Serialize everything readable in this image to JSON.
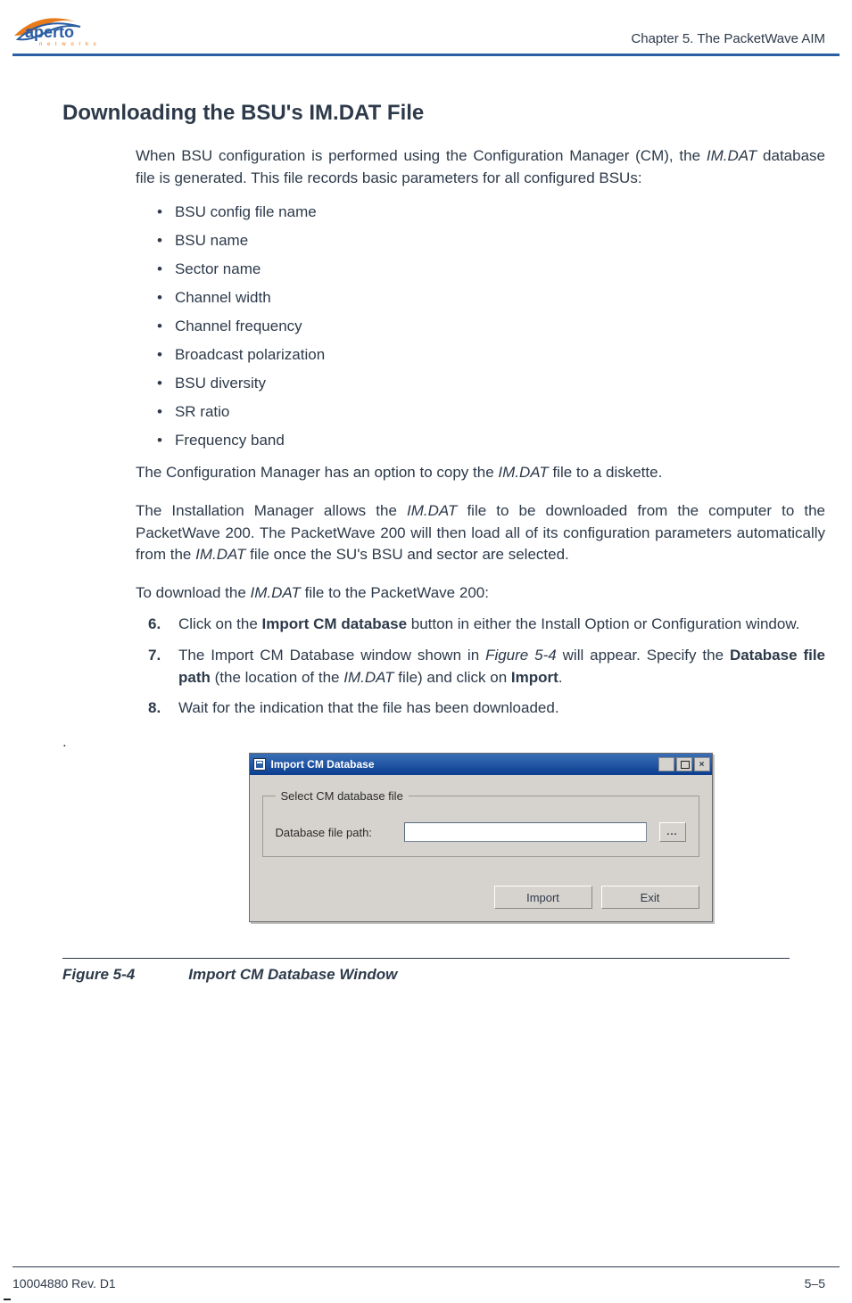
{
  "brand": {
    "name": "aperto",
    "sub": "n e t w o r k s"
  },
  "header": {
    "chapter": "Chapter 5.  The PacketWave AIM"
  },
  "section": {
    "title": "Downloading the BSU's IM.DAT File"
  },
  "para1": {
    "pre": "When BSU configuration is performed using the Configuration Manager (CM), the ",
    "it1": "IM.DAT",
    "post": " database file is generated. This file records basic parameters for all configured BSUs:"
  },
  "bullets": [
    "BSU config file name",
    "BSU name",
    "Sector name",
    "Channel width",
    "Channel frequency",
    "Broadcast polarization",
    "BSU diversity",
    "SR ratio",
    "Frequency band"
  ],
  "para2": {
    "pre": "The Configuration Manager has an option to copy the ",
    "it1": "IM.DAT",
    "post": " file to a diskette."
  },
  "para3": {
    "pre": "The Installation Manager allows the ",
    "it1": "IM.DAT",
    "mid": " file to be downloaded from the computer to the PacketWave 200. The PacketWave 200 will then load all of its configuration parame­ters automatically from the ",
    "it2": "IM.DAT",
    "post": " file once the SU's BSU and sector are selected."
  },
  "para4": {
    "pre": "To download the ",
    "it1": "IM.DAT",
    "post": " file to the PacketWave 200:"
  },
  "steps": {
    "s6": {
      "num": "6.",
      "pre": "Click on the ",
      "b1": "Import CM database",
      "post": " button in either the Install Option or Configura­tion window."
    },
    "s7": {
      "num": "7.",
      "pre": "The Import CM Database window shown in ",
      "it1": "Figure 5-4",
      "mid": " will appear. Specify the ",
      "b1": "Data­base file path",
      "mid2": " (the location of the ",
      "it2": "IM.DAT",
      "mid3": " file) and click on ",
      "b2": "Import",
      "post": "."
    },
    "s8": {
      "num": "8.",
      "txt": "Wait for the indication that the file has been downloaded."
    }
  },
  "lone_dot": ".",
  "dialog": {
    "title": "Import CM Database",
    "group_legend": "Select CM database file",
    "path_label": "Database file path:",
    "browse": "...",
    "import": "Import",
    "exit": "Exit",
    "close": "×"
  },
  "figure": {
    "label": "Figure 5-4",
    "title": "Import CM Database Window"
  },
  "footer": {
    "rev": "10004880 Rev. D1",
    "page": "5–5"
  }
}
